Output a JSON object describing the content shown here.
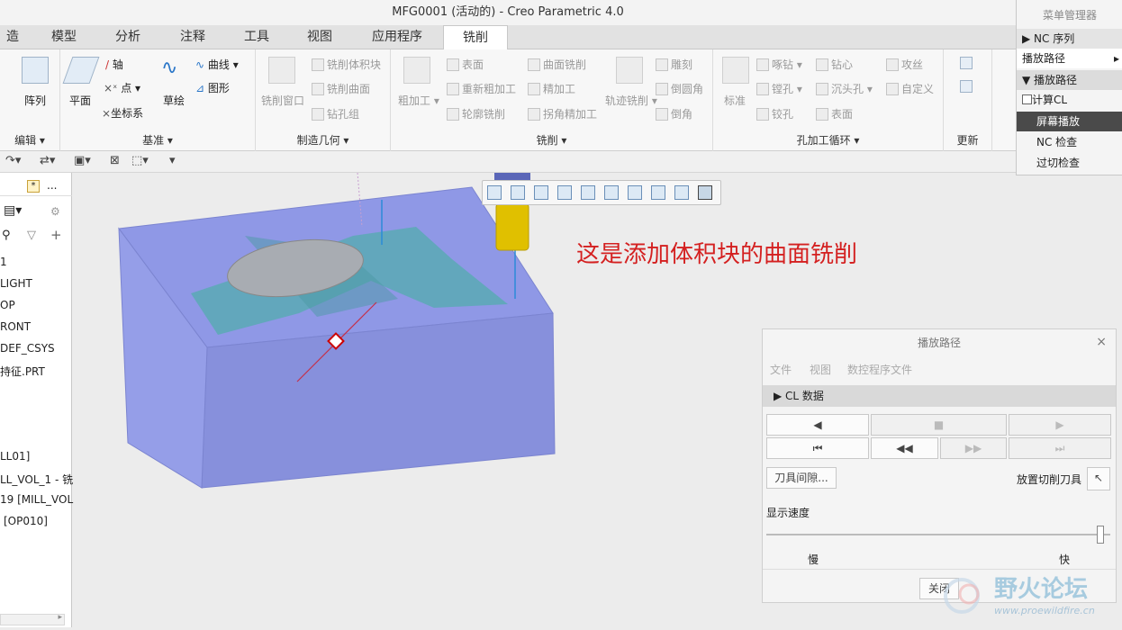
{
  "window": {
    "title": "MFG0001 (活动的) - Creo Parametric 4.0"
  },
  "tabs": [
    "造",
    "模型",
    "分析",
    "注释",
    "工具",
    "视图",
    "应用程序",
    "铣削"
  ],
  "active_tab": "铣削",
  "ribbon": {
    "edit": {
      "label": "编辑",
      "array": "阵列"
    },
    "datum": {
      "label": "基准",
      "plane": "平面",
      "axis": "轴",
      "point": "点",
      "csys": "坐标系",
      "sketch": "草绘",
      "curve": "曲线",
      "graph": "图形"
    },
    "mfg_geom": {
      "label": "制造几何",
      "mill_window": "铣削窗口",
      "mill_volume": "铣削体积块",
      "mill_surface": "铣削曲面",
      "drill_group": "钻孔组"
    },
    "milling": {
      "label": "铣削",
      "rough": "粗加工",
      "face": "表面",
      "rerough": "重新粗加工",
      "profile": "轮廓铣削",
      "surface_mill": "曲面铣削",
      "finish": "精加工",
      "corner_finish": "拐角精加工",
      "trajectory": "轨迹铣削",
      "engrave": "雕刻",
      "round": "倒圆角",
      "chamfer": "倒角"
    },
    "hole": {
      "label": "孔加工循环",
      "standard": "标准",
      "peck": "啄钻",
      "boring": "镗孔",
      "ream": "铰孔",
      "spot": "钻心",
      "countersink": "沉头孔",
      "face": "表面",
      "tap": "攻丝",
      "custom": "自定义"
    },
    "update": {
      "label": "更新"
    }
  },
  "model_tree": {
    "tab_star": "*",
    "tab_more": "...",
    "items": [
      "1",
      "LIGHT",
      "OP",
      "RONT",
      "DEF_CSYS",
      "持征.PRT",
      "LL01]",
      "LL_VOL_1 - 铣",
      "19 [MILL_VOL",
      "[OP010]"
    ]
  },
  "annotation": "这是添加体积块的曲面铣削",
  "menu_manager": {
    "title": "菜单管理器",
    "nc_sequence": "NC 序列",
    "play_path": "播放路径",
    "play_path_head": "播放路径",
    "compute_cl": "计算CL",
    "screen_play": "屏幕播放",
    "nc_check": "NC 检查",
    "gouge_check": "过切检查"
  },
  "dialog": {
    "title": "播放路径",
    "menu": [
      "文件",
      "视图",
      "数控程序文件"
    ],
    "cl_data": "CL 数据",
    "tool_clearance": "刀具间隙...",
    "place_cutter": "放置切削刀具",
    "display_speed": "显示速度",
    "slow": "慢",
    "fast": "快",
    "close": "关闭",
    "speed_level": 0.98
  },
  "watermark": {
    "name": "野火论坛",
    "url": "www.proewildfire.cn"
  },
  "colors": {
    "block": "#8c96e0",
    "toolpath": "#5aa9b4",
    "cutter": "#e0c000",
    "annot": "#d42020"
  }
}
